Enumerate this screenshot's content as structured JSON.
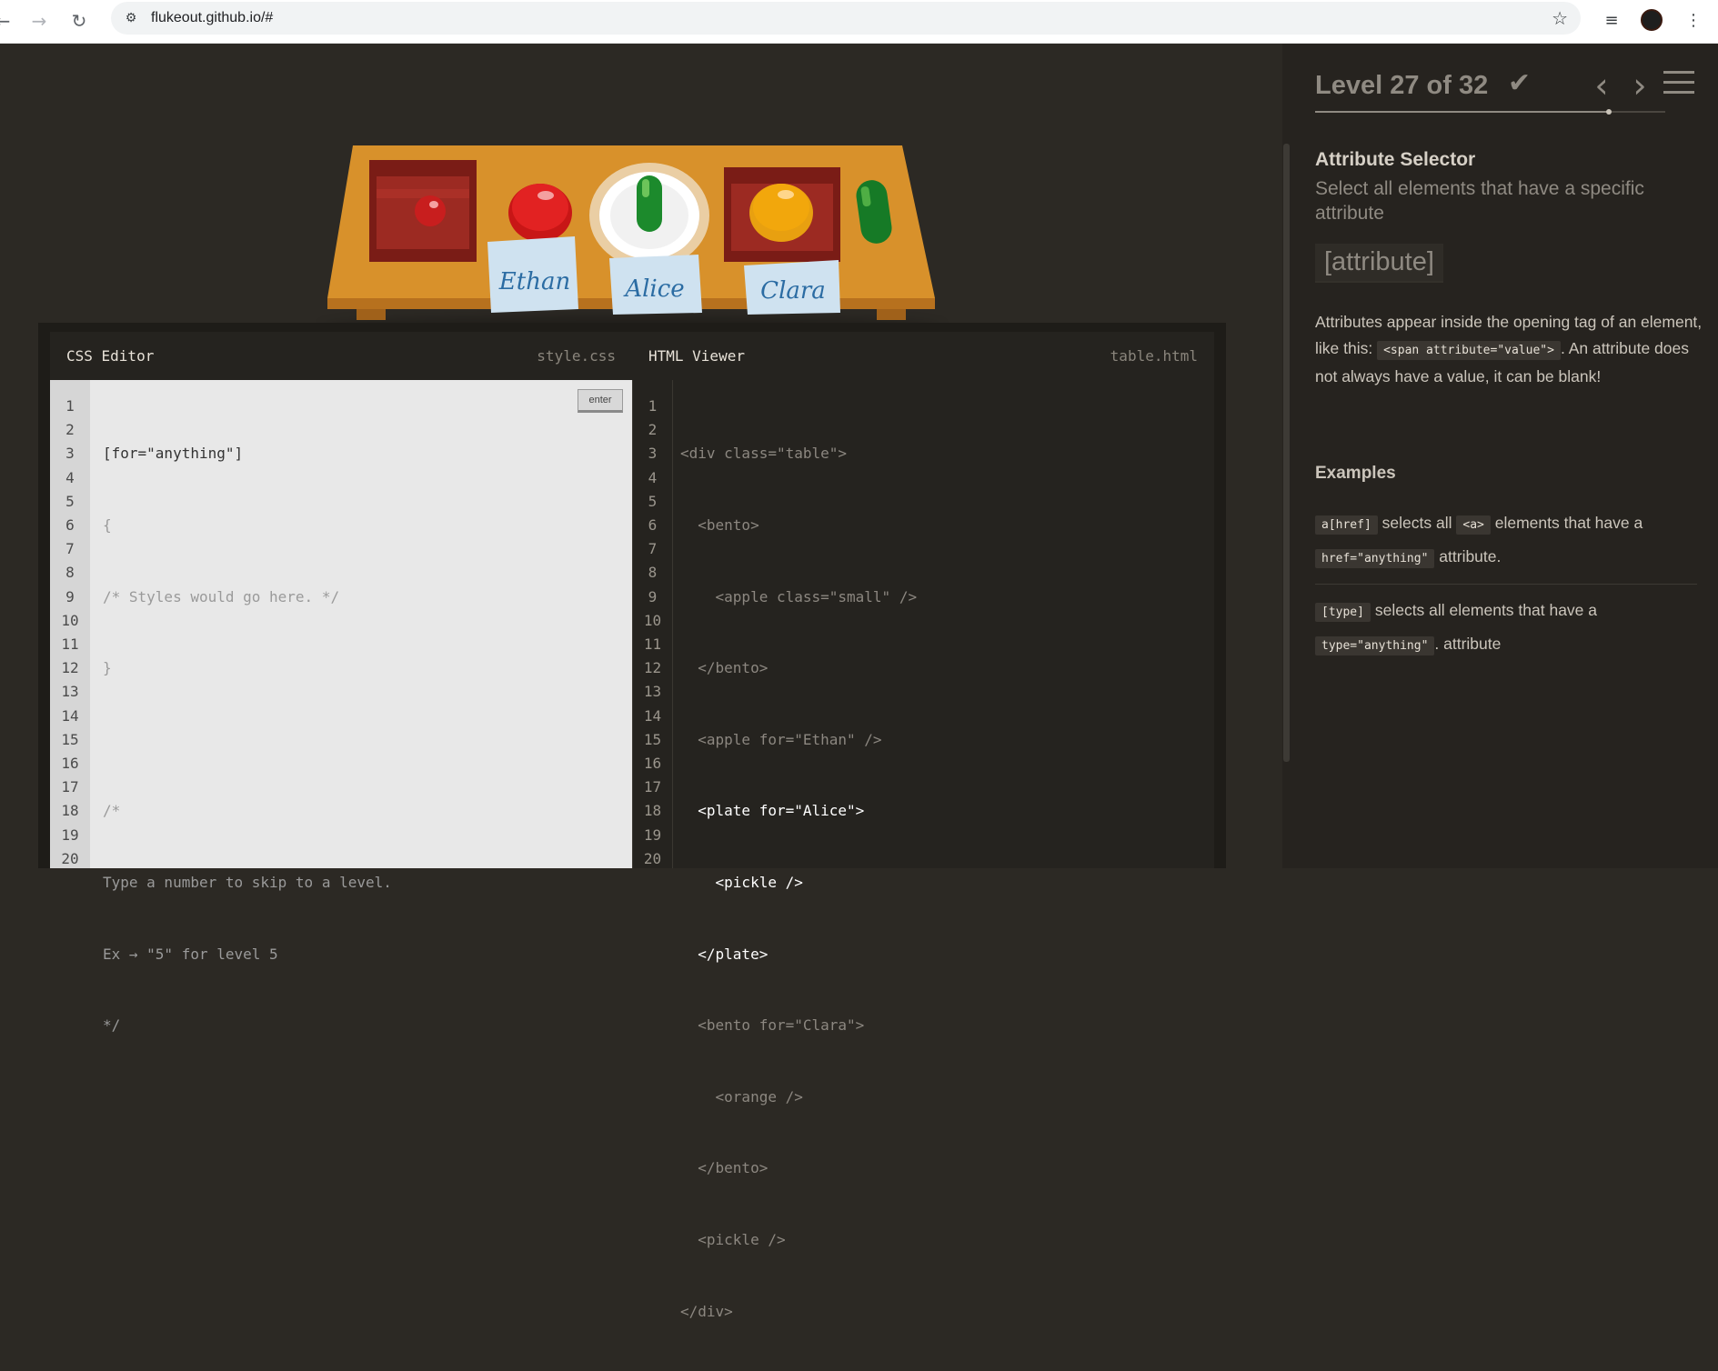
{
  "browser": {
    "url": "flukeout.github.io/#",
    "back_icon": "←",
    "forward_icon": "→",
    "reload_icon": "↻",
    "site_info_icon": "⚙",
    "star_icon": "☆",
    "media_icon": "≡",
    "menu_icon": "⋮"
  },
  "table": {
    "names": [
      "Ethan",
      "Alice",
      "Clara"
    ]
  },
  "css_editor": {
    "title": "CSS Editor",
    "file": "style.css",
    "enter_label": "enter",
    "line_numbers": [
      "1",
      "2",
      "3",
      "4",
      "5",
      "6",
      "7",
      "8",
      "9",
      "10",
      "11",
      "12",
      "13",
      "14",
      "15",
      "16",
      "17",
      "18",
      "19",
      "20"
    ],
    "lines": [
      "[for=\"anything\"]",
      "{",
      "/* Styles would go here. */",
      "}",
      "",
      "/*",
      "Type a number to skip to a level.",
      "Ex → \"5\" for level 5",
      "*/"
    ]
  },
  "html_viewer": {
    "title": "HTML Viewer",
    "file": "table.html",
    "line_numbers": [
      "1",
      "2",
      "3",
      "4",
      "5",
      "6",
      "7",
      "8",
      "9",
      "10",
      "11",
      "12",
      "13",
      "14",
      "15",
      "16",
      "17",
      "18",
      "19",
      "20"
    ],
    "lines": [
      "<div class=\"table\">",
      "  <bento>",
      "    <apple class=\"small\" />",
      "  </bento>",
      "  <apple for=\"Ethan\" />",
      "  <plate for=\"Alice\">",
      "    <pickle />",
      "  </plate>",
      "  <bento for=\"Clara\">",
      "    <orange />",
      "  </bento>",
      "  <pickle />",
      "</div>"
    ]
  },
  "sidebar": {
    "level_title": "Level 27 of 32",
    "check_icon": "✔",
    "prev_icon": "‹",
    "next_icon": "›",
    "progress": 0.84,
    "selector_name": "Attribute Selector",
    "selector_title": "Select all elements that have a specific attribute",
    "syntax": "[attribute]",
    "hint_pre": "Attributes appear inside the opening tag of an element, like this:",
    "hint_code": "<span attribute=\"value\">",
    "hint_post": ". An attribute does not always have a value, it can be blank!",
    "examples_heading": "Examples",
    "ex1_code": "a[href]",
    "ex1_text1": "selects all",
    "ex1_code2": "<a>",
    "ex1_text2": "elements that have a",
    "ex1_code3": "href=\"anything\"",
    "ex1_text3": "attribute.",
    "ex2_code": "[type]",
    "ex2_text1": "selects all elements that have a",
    "ex2_code2": "type=\"anything\"",
    "ex2_text2": ". attribute"
  }
}
